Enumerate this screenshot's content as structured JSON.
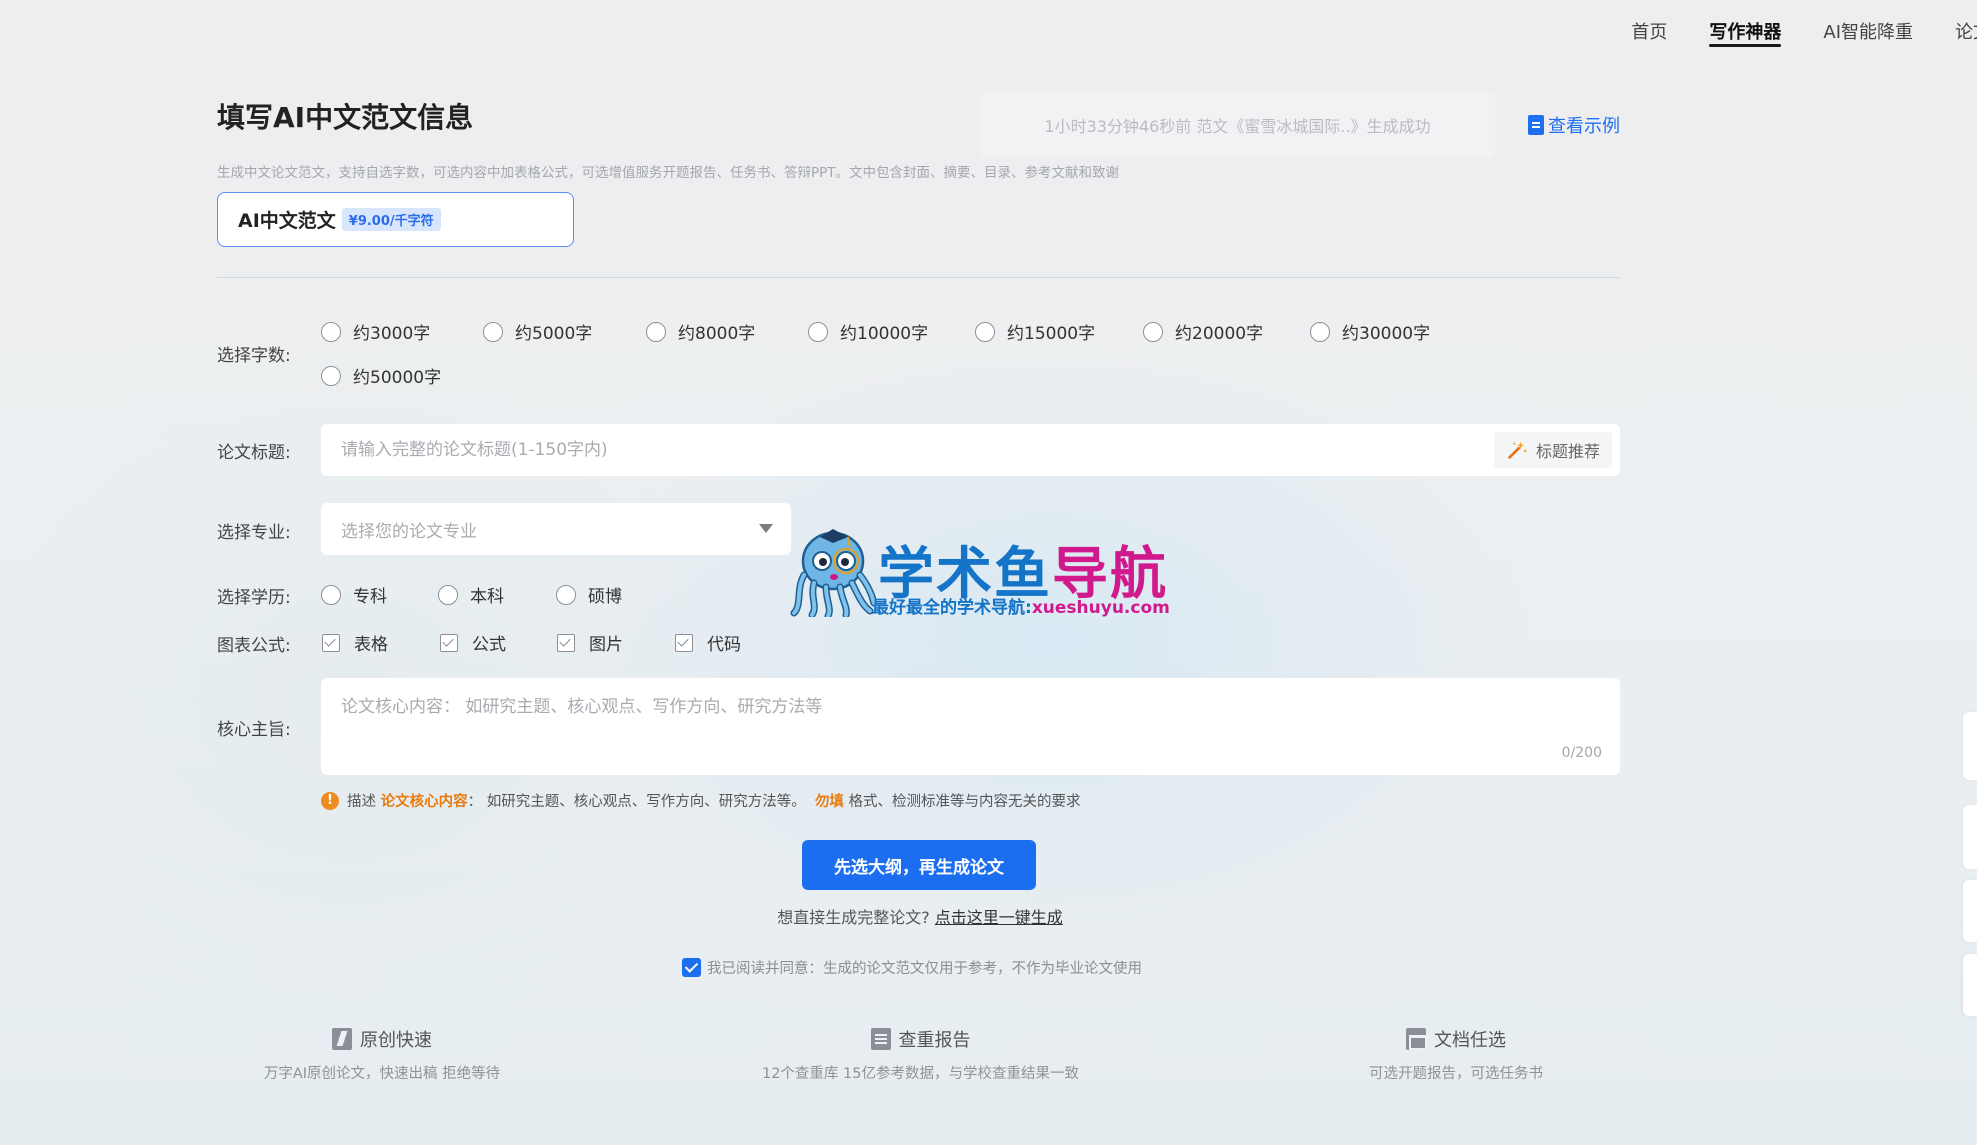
{
  "nav": {
    "items": [
      {
        "label": "首页",
        "active": false
      },
      {
        "label": "写作神器",
        "active": true
      },
      {
        "label": "AI智能降重",
        "active": false
      },
      {
        "label": "论文",
        "active": false
      }
    ]
  },
  "header": {
    "title": "填写AI中文范文信息",
    "ticker": "1小时33分钟46秒前 范文《蜜雪冰城国际..》生成成功",
    "example_link": "查看示例",
    "subtitle": "生成中文论文范文，支持自选字数，可选内容中加表格公式，可选增值服务开题报告、任务书、答辩PPT。文中包含封面、摘要、目录、参考文献和致谢"
  },
  "type_card": {
    "name": "AI中文范文",
    "price": "¥9.00/千字符"
  },
  "form": {
    "word_count": {
      "label": "选择字数:",
      "options": [
        "约3000字",
        "约5000字",
        "约8000字",
        "约10000字",
        "约15000字",
        "约20000字",
        "约30000字",
        "约50000字"
      ]
    },
    "title": {
      "label": "论文标题:",
      "placeholder": "请输入完整的论文标题(1-150字内)",
      "suggest_button": "标题推荐"
    },
    "major": {
      "label": "选择专业:",
      "placeholder": "选择您的论文专业"
    },
    "education": {
      "label": "选择学历:",
      "options": [
        "专科",
        "本科",
        "硕博"
      ]
    },
    "charts": {
      "label": "图表公式:",
      "options": [
        "表格",
        "公式",
        "图片",
        "代码"
      ]
    },
    "core": {
      "label": "核心主旨:",
      "placeholder": "论文核心内容： 如研究主题、核心观点、写作方向、研究方法等",
      "counter": "0/200"
    },
    "hint": {
      "prefix": "描述",
      "highlight1": "论文核心内容",
      "middle": "： 如研究主题、核心观点、写作方向、研究方法等。",
      "highlight2": "勿填",
      "suffix": "格式、检测标准等与内容无关的要求"
    }
  },
  "actions": {
    "primary": "先选大纲，再生成论文",
    "direct_prefix": "想直接生成完整论文?",
    "direct_link": "点击这里一键生成",
    "agree": "我已阅读并同意：生成的论文范文仅用于参考，不作为毕业论文使用"
  },
  "features": [
    {
      "title": "原创快速",
      "desc": "万字AI原创论文，快速出稿 拒绝等待"
    },
    {
      "title": "查重报告",
      "desc": "12个查重库 15亿参考数据，与学校查重结果一致"
    },
    {
      "title": "文档任选",
      "desc": "可选开题报告，可选任务书"
    }
  ],
  "watermark": {
    "main_blue": "学术鱼",
    "main_magenta": "导航",
    "sub_blue": "最好最全的学术导航:",
    "sub_magenta": "xueshuyu.com"
  },
  "colors": {
    "accent": "#1c6ef0",
    "hint_orange": "#e97b11",
    "watermark_blue": "#1474c7",
    "watermark_magenta": "#d0198c"
  }
}
